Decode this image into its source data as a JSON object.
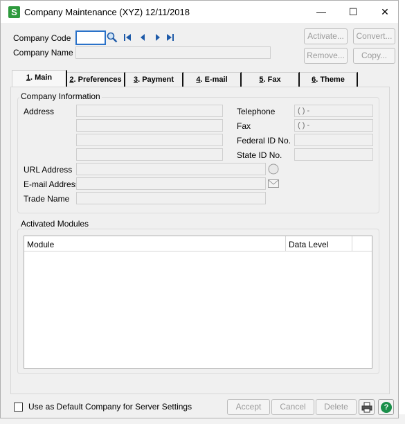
{
  "window": {
    "title": "Company Maintenance (XYZ) 12/11/2018",
    "app_icon": "S",
    "controls": {
      "minimize": "—",
      "maximize": "☐",
      "close": "✕"
    }
  },
  "header": {
    "company_code_label": "Company Code",
    "company_code_value": "",
    "company_name_label": "Company Name",
    "company_name_value": ""
  },
  "actions": {
    "activate": "Activate...",
    "convert": "Convert...",
    "remove": "Remove...",
    "copy": "Copy..."
  },
  "tabs": [
    {
      "num": "1",
      "label": ". Main"
    },
    {
      "num": "2",
      "label": ". Preferences"
    },
    {
      "num": "3",
      "label": ". Payment"
    },
    {
      "num": "4",
      "label": ". E-mail"
    },
    {
      "num": "5",
      "label": ". Fax"
    },
    {
      "num": "6",
      "label": ". Theme"
    }
  ],
  "company_info": {
    "title": "Company Information",
    "address_label": "Address",
    "url_label": "URL Address",
    "email_label": "E-mail Address",
    "trade_name_label": "Trade Name",
    "telephone_label": "Telephone",
    "telephone_value": "(   )       -",
    "fax_label": "Fax",
    "fax_value": "(   )       -",
    "federal_id_label": "Federal ID No.",
    "state_id_label": "State ID No."
  },
  "modules": {
    "title": "Activated Modules",
    "columns": [
      "Module",
      "Data Level"
    ],
    "rows": []
  },
  "footer": {
    "default_company_label": "Use as Default Company for Server Settings",
    "accept": "Accept",
    "cancel": "Cancel",
    "delete": "Delete",
    "help_glyph": "?"
  },
  "colors": {
    "accent": "#2a72c9",
    "app_icon_green": "#2e9a3d",
    "disabled_text": "#9a9a9a"
  }
}
